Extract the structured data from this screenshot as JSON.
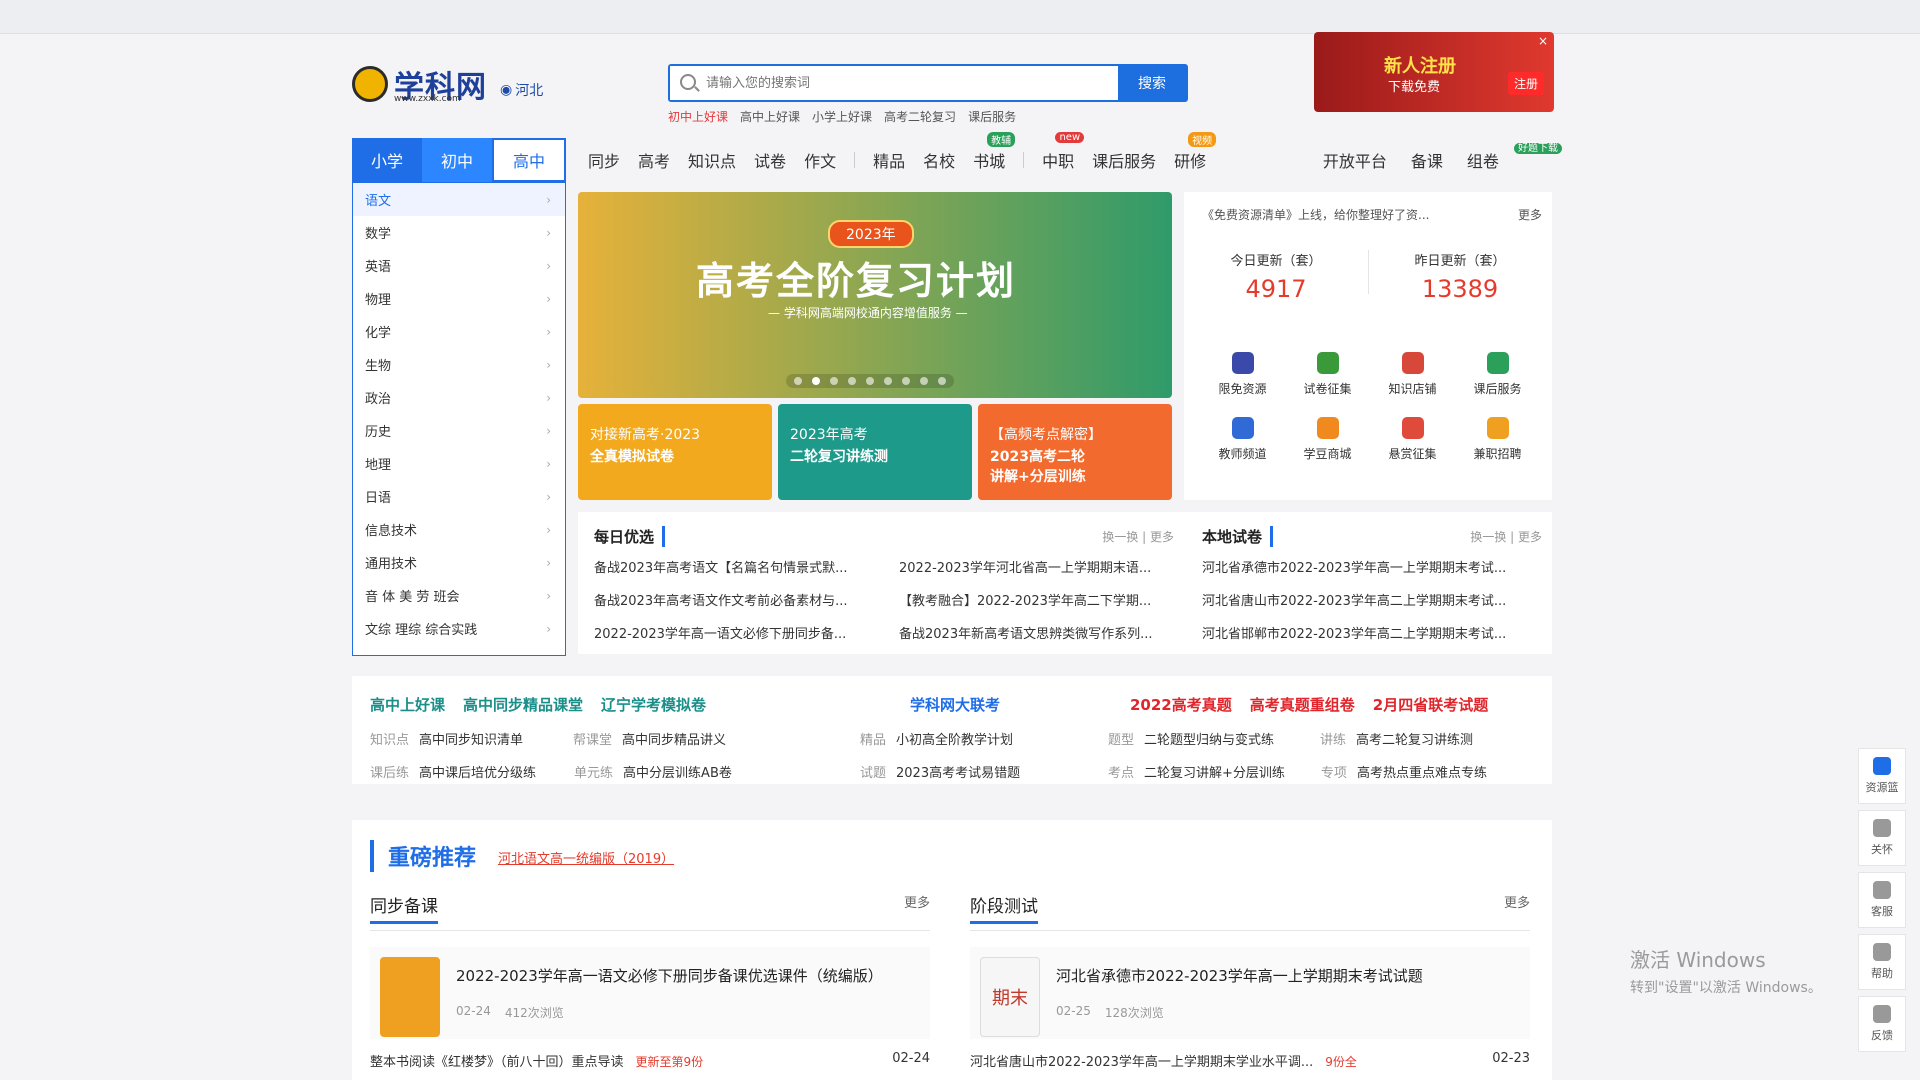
{
  "topbar": {
    "left": "",
    "right_items": [
      "",
      "",
      "",
      "",
      "",
      ""
    ]
  },
  "header": {
    "logo_text": "学科网",
    "logo_sub": "www.zxxk.com",
    "location": "河北",
    "search_placeholder": "请输入您的搜索词",
    "search_button": "搜索",
    "hotwords": [
      "初中上好课",
      "高中上好课",
      "小学上好课",
      "高考二轮复习",
      "课后服务"
    ],
    "promo": {
      "line1": "新人注册",
      "line2": "下载免费",
      "btn": "注册",
      "close": "×"
    }
  },
  "nav": {
    "stages": [
      "小学",
      "初中",
      "高中"
    ],
    "links": [
      "同步",
      "高考",
      "知识点",
      "试卷",
      "作文",
      "精品",
      "名校",
      "书城",
      "中职",
      "课后服务",
      "研修"
    ],
    "tags": {
      "shucheng": "教辅",
      "zhongzhi": "new",
      "yanxiu": "视频"
    },
    "right": [
      "开放平台",
      "备课",
      "组卷"
    ],
    "zujuan_tag": "好题下载"
  },
  "sidebar": {
    "subjects": [
      "语文",
      "数学",
      "英语",
      "物理",
      "化学",
      "生物",
      "政治",
      "历史",
      "地理",
      "日语",
      "信息技术",
      "通用技术",
      "音 体 美 劳 班会",
      "文综 理综 综合实践"
    ]
  },
  "banner": {
    "year": "2023年",
    "title": "高考全阶复习计划",
    "sub": "— 学科网高端网校通内容增值服务 —",
    "mini": [
      {
        "l1": "对接新高考·2023",
        "l2": "全真模拟试卷",
        "l3": ""
      },
      {
        "l1": "2023年高考",
        "l2": "二轮复习讲练测",
        "l3": ""
      },
      {
        "l1": "【高频考点解密】",
        "l2": "2023高考二轮",
        "l3": "讲解+分层训练"
      }
    ]
  },
  "info": {
    "notice": "《免费资源清单》上线，给你整理好了资...",
    "more": "更多",
    "today_label": "今日更新（套）",
    "today_num": "4917",
    "yesterday_label": "昨日更新（套）",
    "yesterday_num": "13389",
    "quick": [
      "限免资源",
      "试卷征集",
      "知识店铺",
      "课后服务",
      "教师频道",
      "学豆商城",
      "悬赏征集",
      "兼职招聘"
    ]
  },
  "lists": {
    "daily_title": "每日优选",
    "local_title": "本地试卷",
    "ops": "换一换 | 更多",
    "daily": [
      "备战2023年高考语文【名篇名句情景式默...",
      "2022-2023学年河北省高一上学期期末语...",
      "备战2023年高考语文作文考前必备素材与...",
      "【教考融合】2022-2023学年高二下学期...",
      "2022-2023学年高一语文必修下册同步备...",
      "备战2023年新高考语文思辨类微写作系列..."
    ],
    "local": [
      "河北省承德市2022-2023学年高一上学期期末考试...",
      "河北省唐山市2022-2023学年高二上学期期末考试...",
      "河北省邯郸市2022-2023学年高二上学期期末考试..."
    ]
  },
  "feature": {
    "g1_heads": [
      "高中上好课",
      "高中同步精品课堂",
      "辽宁学考模拟卷"
    ],
    "g1_rows": [
      [
        "知识点",
        "高中同步知识清单",
        "帮课堂",
        "高中同步精品讲义"
      ],
      [
        "课后练",
        "高中课后培优分级练",
        "单元练",
        "高中分层训练AB卷"
      ]
    ],
    "g2_heads": [
      "学科网大联考"
    ],
    "g2_rows": [
      [
        "精品",
        "小初高全阶教学计划"
      ],
      [
        "试题",
        "2023高考考试易错题"
      ]
    ],
    "g3_heads": [
      "2022高考真题",
      "高考真题重组卷",
      "2月四省联考试题"
    ],
    "g3_rows": [
      [
        "题型",
        "二轮题型归纳与变式练",
        "讲练",
        "高考二轮复习讲练测"
      ],
      [
        "考点",
        "二轮复习讲解+分层训练",
        "专项",
        "高考热点重点难点专练"
      ]
    ]
  },
  "recommend": {
    "title": "重磅推荐",
    "sub": "河北语文高一统编版（2019）",
    "sec1": {
      "title": "同步备课",
      "more": "更多",
      "card_title": "2022-2023学年高一语文必修下册同步备课优选课件（统编版）",
      "card_date": "02-24",
      "card_views": "412次浏览",
      "item": "整本书阅读《红楼梦》（前八十回）重点导读",
      "item_hl": "更新至第9份",
      "item_date": "02-24"
    },
    "sec2": {
      "title": "阶段测试",
      "more": "更多",
      "thumb": "期末",
      "card_title": "河北省承德市2022-2023学年高一上学期期末考试试题",
      "card_date": "02-25",
      "card_views": "128次浏览",
      "item": "河北省唐山市2022-2023学年高一上学期期末学业水平调...",
      "item_hl": "9份全",
      "item_date": "02-23"
    }
  },
  "rightbar": [
    "资源篮",
    "关怀",
    "客服",
    "帮助",
    "反馈"
  ],
  "windows": {
    "line1": "激活 Windows",
    "line2": "转到\"设置\"以激活 Windows。"
  }
}
